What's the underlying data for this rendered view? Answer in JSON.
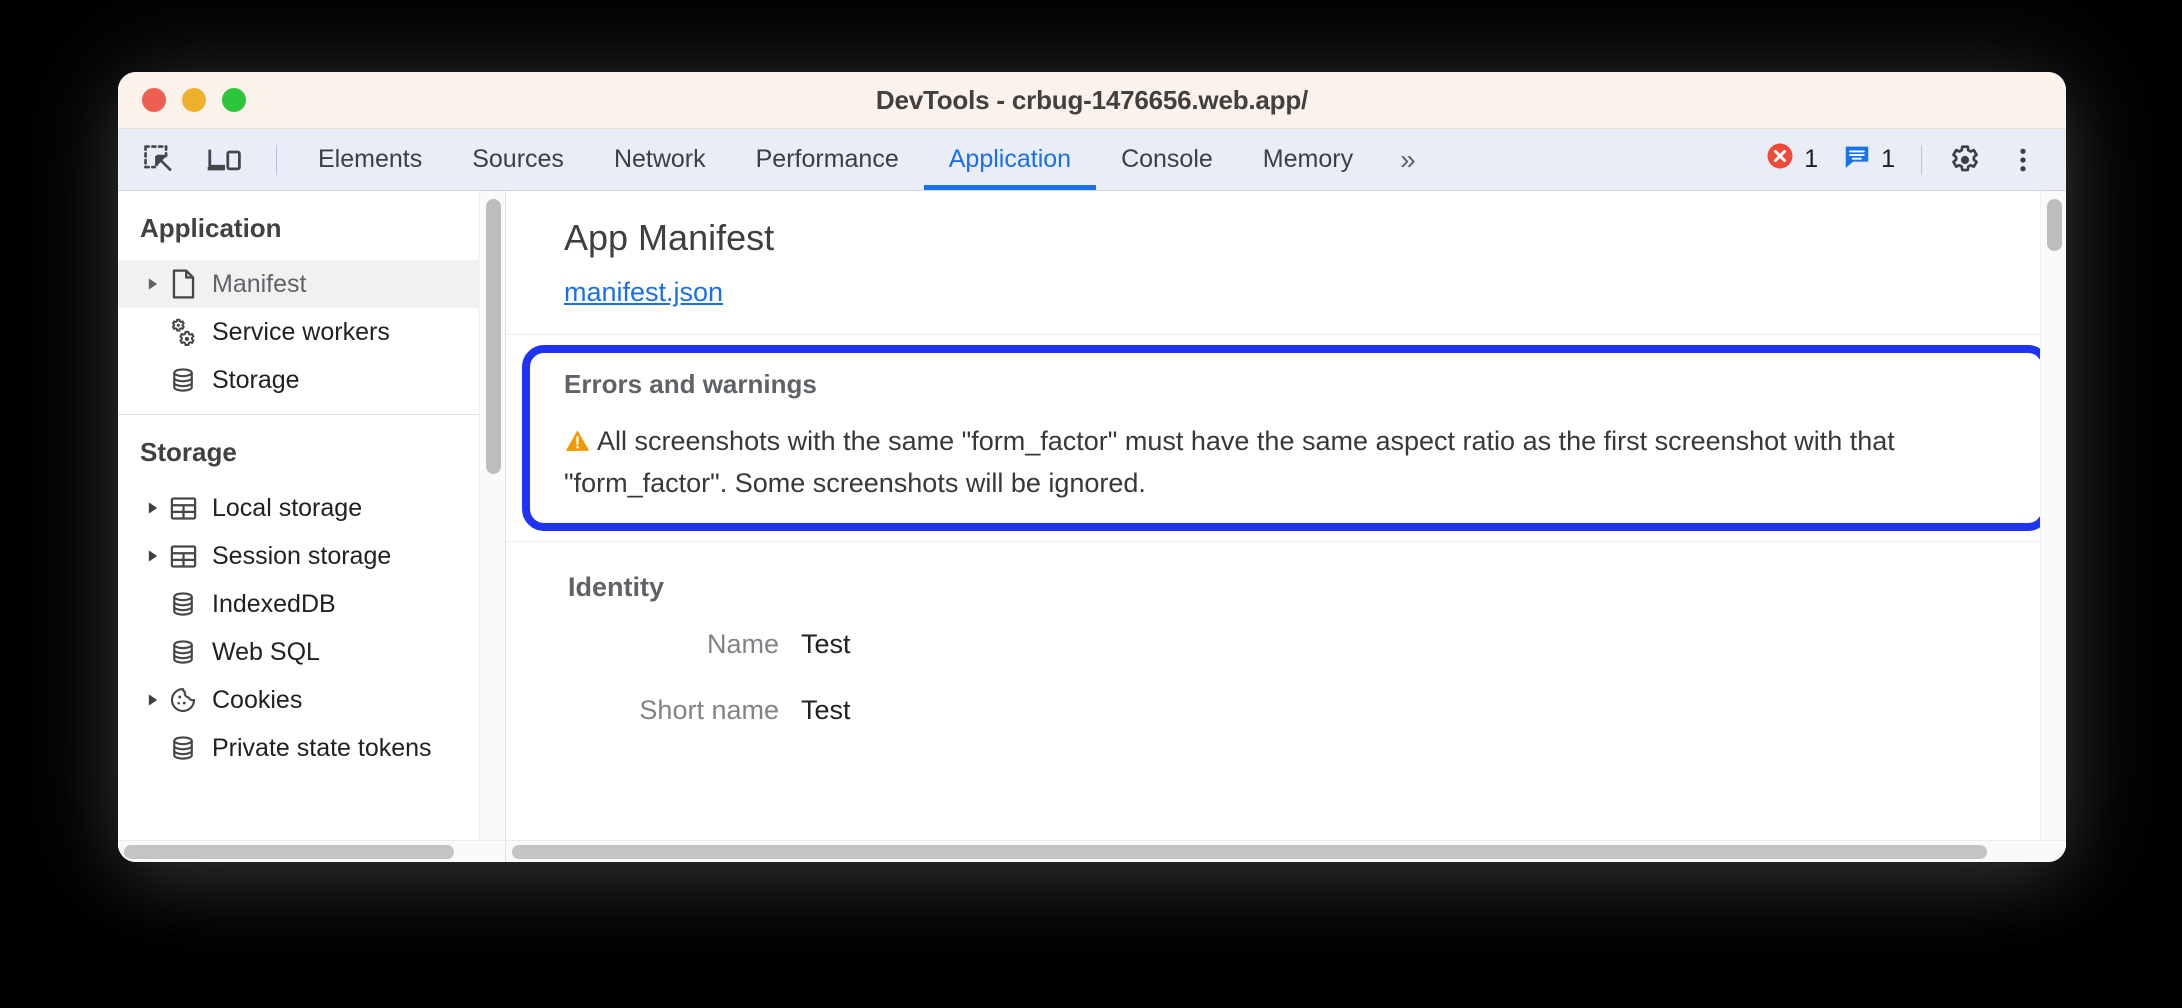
{
  "window": {
    "title": "DevTools - crbug-1476656.web.app/",
    "traffic_lights": [
      "close",
      "minimize",
      "zoom"
    ],
    "colors": {
      "titlebar_bg": "#fbf2ec",
      "tabbar_bg": "#e9edf7",
      "accent_blue": "#1a6fef",
      "highlight_blue": "#1f33f5",
      "warning_orange": "#f29900",
      "error_red": "#ee4b3a"
    }
  },
  "toolbar": {
    "inspect_icon": "inspect-element-icon",
    "device_icon": "device-toolbar-icon",
    "tabs": [
      {
        "label": "Elements",
        "active": false
      },
      {
        "label": "Sources",
        "active": false
      },
      {
        "label": "Network",
        "active": false
      },
      {
        "label": "Performance",
        "active": false
      },
      {
        "label": "Application",
        "active": true
      },
      {
        "label": "Console",
        "active": false
      },
      {
        "label": "Memory",
        "active": false
      }
    ],
    "more_tabs_label": "»",
    "error_count": "1",
    "message_count": "1",
    "settings_icon": "gear-icon",
    "menu_icon": "kebab-menu-icon"
  },
  "sidebar": {
    "groups": [
      {
        "header": "Application",
        "items": [
          {
            "label": "Manifest",
            "icon": "document-icon",
            "twisty": true,
            "selected": true
          },
          {
            "label": "Service workers",
            "icon": "gears-icon",
            "twisty": false,
            "selected": false
          },
          {
            "label": "Storage",
            "icon": "database-icon",
            "twisty": false,
            "selected": false
          }
        ]
      },
      {
        "header": "Storage",
        "items": [
          {
            "label": "Local storage",
            "icon": "table-icon",
            "twisty": true,
            "selected": false
          },
          {
            "label": "Session storage",
            "icon": "table-icon",
            "twisty": true,
            "selected": false
          },
          {
            "label": "IndexedDB",
            "icon": "database-icon",
            "twisty": false,
            "selected": false
          },
          {
            "label": "Web SQL",
            "icon": "database-icon",
            "twisty": false,
            "selected": false
          },
          {
            "label": "Cookies",
            "icon": "cookie-icon",
            "twisty": true,
            "selected": false
          },
          {
            "label": "Private state tokens",
            "icon": "database-icon",
            "twisty": false,
            "selected": false
          }
        ]
      }
    ]
  },
  "main": {
    "page_title": "App Manifest",
    "manifest_link": "manifest.json",
    "errors_section": {
      "heading": "Errors and warnings",
      "warning_icon": "warning-triangle-icon",
      "message": "All screenshots with the same \"form_factor\" must have the same aspect ratio as the first screenshot with that \"form_factor\". Some screenshots will be ignored."
    },
    "identity_section": {
      "heading": "Identity",
      "fields": [
        {
          "key": "Name",
          "value": "Test"
        },
        {
          "key": "Short name",
          "value": "Test"
        }
      ]
    }
  }
}
